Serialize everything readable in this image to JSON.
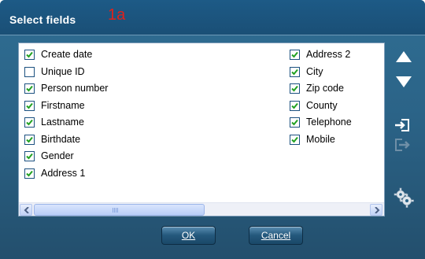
{
  "dialog": {
    "title": "Select fields",
    "marker": "1a"
  },
  "fields_left": [
    {
      "label": "Create date",
      "checked": true
    },
    {
      "label": "Unique ID",
      "checked": false
    },
    {
      "label": "Person number",
      "checked": true
    },
    {
      "label": "Firstname",
      "checked": true
    },
    {
      "label": "Lastname",
      "checked": true
    },
    {
      "label": "Birthdate",
      "checked": true
    },
    {
      "label": "Gender",
      "checked": true
    },
    {
      "label": "Address 1",
      "checked": true
    }
  ],
  "fields_right": [
    {
      "label": "Address 2",
      "checked": true
    },
    {
      "label": "City",
      "checked": true
    },
    {
      "label": "Zip code",
      "checked": true
    },
    {
      "label": "County",
      "checked": true
    },
    {
      "label": "Telephone",
      "checked": true
    },
    {
      "label": "Mobile",
      "checked": true
    }
  ],
  "side_tools": {
    "move_up": "arrow-up-icon",
    "move_down": "arrow-down-icon",
    "import": "import-icon",
    "export": "export-icon",
    "settings": "gears-icon"
  },
  "buttons": {
    "ok": "OK",
    "cancel": "Cancel"
  },
  "colors": {
    "title_bar": "#1a4f76",
    "dialog_bg": "#2b6387",
    "marker": "#e0211b",
    "checkmark": "#21a121"
  }
}
